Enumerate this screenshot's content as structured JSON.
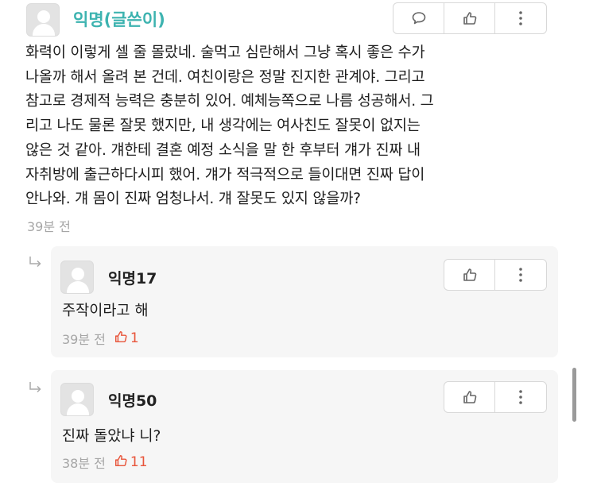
{
  "post_comment": {
    "author": "익명(글쓴이)",
    "lines": [
      "화력이 이렇게 셀 줄 몰랐네. 술먹고 심란해서 그냥 혹시 좋은 수가",
      "나올까 해서 올려 본 건데. 여친이랑은 정말 진지한 관계야. 그리고",
      "참고로 경제적 능력은 충분히 있어. 예체능쪽으로 나름 성공해서. 그",
      "리고 나도 물론 잘못 했지만, 내 생각에는 여사친도 잘못이 없지는",
      "않은 것 같아. 걔한테 결혼 예정 소식을 말 한 후부터 걔가 진짜 내",
      "자취방에 출근하다시피 했어. 걔가 적극적으로 들이대면 진짜 답이",
      "안나와. 걔 몸이 진짜 엄청나서. 걔 잘못도 있지 않을까?"
    ],
    "time": "39분 전",
    "icons": [
      "speech-bubble-icon",
      "thumbs-up-icon",
      "more-vertical-icon"
    ]
  },
  "replies": [
    {
      "author": "익명17",
      "text": "주작이라고 해",
      "time": "39분 전",
      "likes": "1"
    },
    {
      "author": "익명50",
      "text": "진짜 돌았냐 니?",
      "time": "38분 전",
      "likes": "11"
    }
  ],
  "colors": {
    "op_author": "#3db3b0",
    "like": "#e8553b",
    "reply_bg": "#f6f6f6",
    "meta": "#a6a6a6"
  }
}
